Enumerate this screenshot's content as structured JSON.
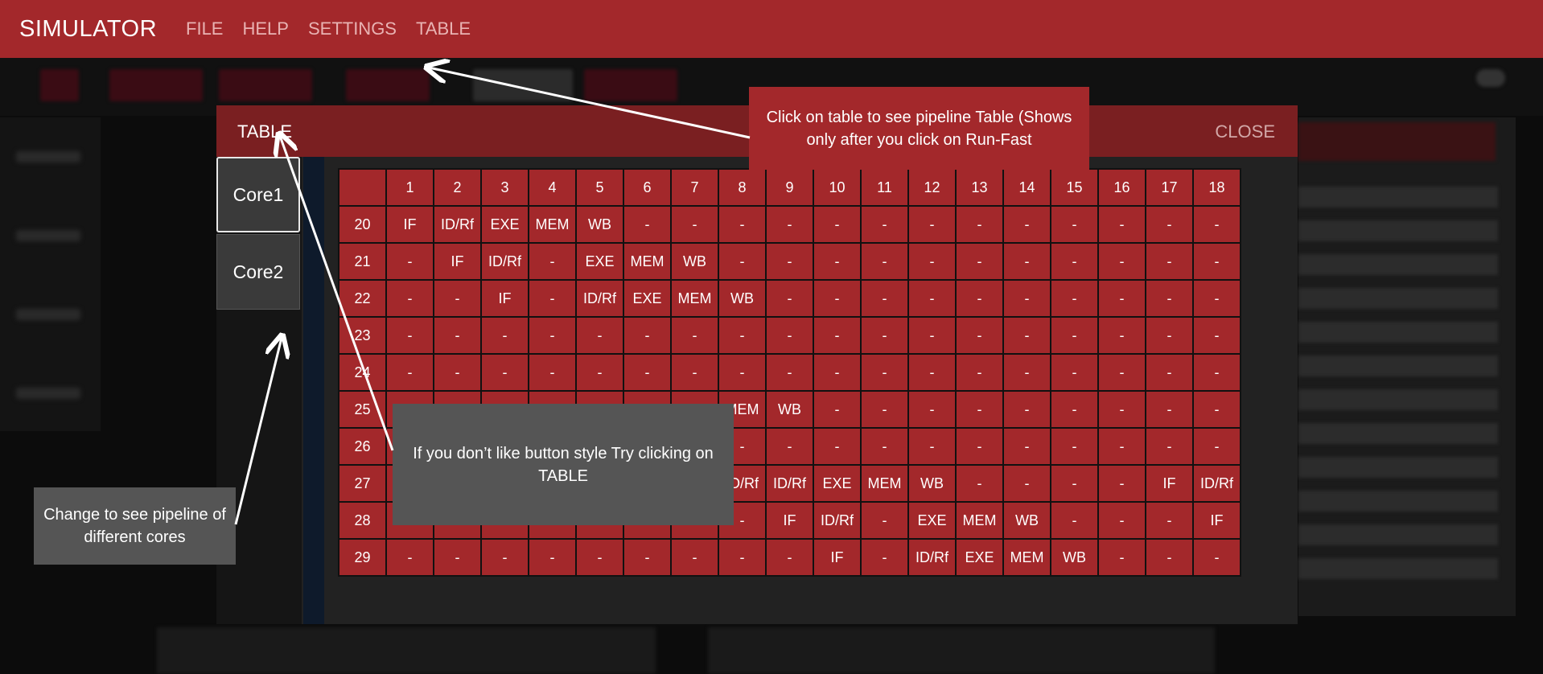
{
  "app": {
    "brand": "SIMULATOR",
    "menu": [
      "FILE",
      "HELP",
      "SETTINGS",
      "TABLE"
    ]
  },
  "modal": {
    "title": "TABLE",
    "close_label": "CLOSE",
    "cores": [
      "Core1",
      "Core2"
    ],
    "active_core": "Core1"
  },
  "table": {
    "columns": [
      "",
      "1",
      "2",
      "3",
      "4",
      "5",
      "6",
      "7",
      "8",
      "9",
      "10",
      "11",
      "12",
      "13",
      "14",
      "15",
      "16",
      "17",
      "18"
    ],
    "rows": [
      {
        "label": "20",
        "cells": [
          "IF",
          "ID/Rf",
          "EXE",
          "MEM",
          "WB",
          "-",
          "-",
          "-",
          "-",
          "-",
          "-",
          "-",
          "-",
          "-",
          "-",
          "-",
          "-",
          "-"
        ]
      },
      {
        "label": "21",
        "cells": [
          "-",
          "IF",
          "ID/Rf",
          "-",
          "EXE",
          "MEM",
          "WB",
          "-",
          "-",
          "-",
          "-",
          "-",
          "-",
          "-",
          "-",
          "-",
          "-",
          "-"
        ]
      },
      {
        "label": "22",
        "cells": [
          "-",
          "-",
          "IF",
          "-",
          "ID/Rf",
          "EXE",
          "MEM",
          "WB",
          "-",
          "-",
          "-",
          "-",
          "-",
          "-",
          "-",
          "-",
          "-",
          "-"
        ]
      },
      {
        "label": "23",
        "cells": [
          "-",
          "-",
          "-",
          "-",
          "-",
          "-",
          "-",
          "-",
          "-",
          "-",
          "-",
          "-",
          "-",
          "-",
          "-",
          "-",
          "-",
          "-"
        ]
      },
      {
        "label": "24",
        "cells": [
          "-",
          "-",
          "-",
          "-",
          "-",
          "-",
          "-",
          "-",
          "-",
          "-",
          "-",
          "-",
          "-",
          "-",
          "-",
          "-",
          "-",
          "-"
        ]
      },
      {
        "label": "25",
        "cells": [
          "",
          "",
          "",
          "",
          "",
          "",
          "",
          "MEM",
          "WB",
          "-",
          "-",
          "-",
          "-",
          "-",
          "-",
          "-",
          "-",
          "-"
        ]
      },
      {
        "label": "26",
        "cells": [
          "",
          "",
          "",
          "",
          "",
          "",
          "",
          "-",
          "-",
          "-",
          "-",
          "-",
          "-",
          "-",
          "-",
          "-",
          "-",
          "-"
        ]
      },
      {
        "label": "27",
        "cells": [
          "",
          "",
          "",
          "",
          "",
          "",
          "",
          "ID/Rf",
          "ID/Rf",
          "EXE",
          "MEM",
          "WB",
          "-",
          "-",
          "-",
          "-",
          "IF",
          "ID/Rf"
        ]
      },
      {
        "label": "28",
        "cells": [
          "-",
          "-",
          "-",
          "-",
          "-",
          "-",
          "-",
          "-",
          "IF",
          "ID/Rf",
          "-",
          "EXE",
          "MEM",
          "WB",
          "-",
          "-",
          "-",
          "IF"
        ]
      },
      {
        "label": "29",
        "cells": [
          "-",
          "-",
          "-",
          "-",
          "-",
          "-",
          "-",
          "-",
          "-",
          "IF",
          "-",
          "ID/Rf",
          "EXE",
          "MEM",
          "WB",
          "-",
          "-",
          "-"
        ]
      }
    ]
  },
  "callouts": {
    "table_menu": "Click on table to see pipeline Table (Shows only after you click on Run-Fast",
    "button_style": "If you don’t like button style Try clicking on TABLE",
    "cores": "Change to see pipeline of different cores"
  },
  "colors": {
    "accent": "#a3282b",
    "header": "#7a1f21",
    "callout_gray": "#555555"
  }
}
